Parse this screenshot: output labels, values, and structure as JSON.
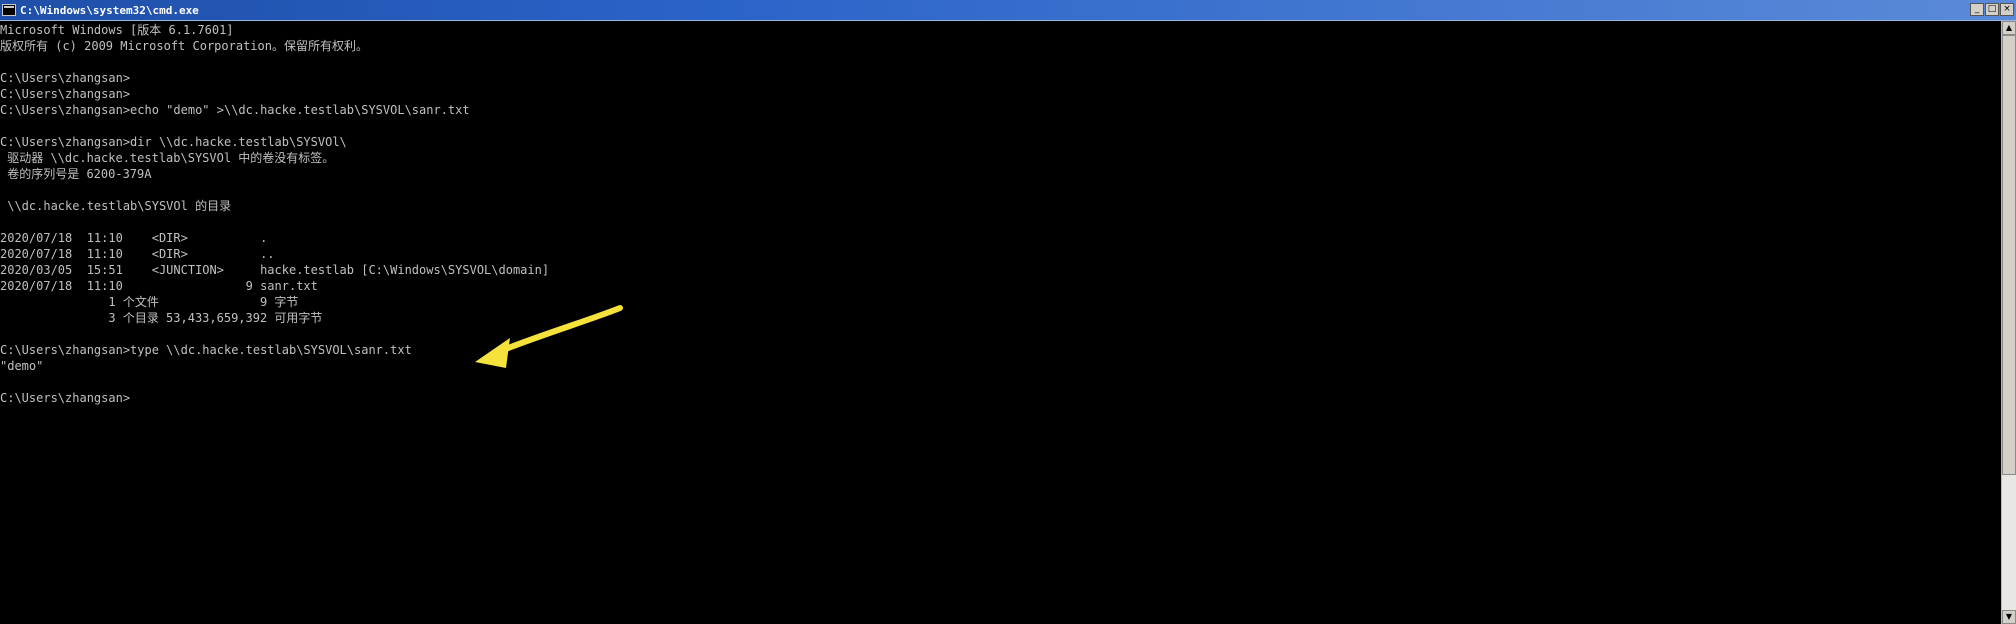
{
  "window": {
    "title": "C:\\Windows\\system32\\cmd.exe",
    "controls": {
      "minimize": "_",
      "maximize": "□",
      "close": "×"
    }
  },
  "console": {
    "lines": [
      "Microsoft Windows [版本 6.1.7601]",
      "版权所有 (c) 2009 Microsoft Corporation。保留所有权利。",
      "",
      "C:\\Users\\zhangsan>",
      "C:\\Users\\zhangsan>",
      "C:\\Users\\zhangsan>echo \"demo\" >\\\\dc.hacke.testlab\\SYSVOL\\sanr.txt",
      "",
      "C:\\Users\\zhangsan>dir \\\\dc.hacke.testlab\\SYSVOl\\",
      " 驱动器 \\\\dc.hacke.testlab\\SYSVOl 中的卷没有标签。",
      " 卷的序列号是 6200-379A",
      "",
      " \\\\dc.hacke.testlab\\SYSVOl 的目录",
      "",
      "2020/07/18  11:10    <DIR>          .",
      "2020/07/18  11:10    <DIR>          ..",
      "2020/03/05  15:51    <JUNCTION>     hacke.testlab [C:\\Windows\\SYSVOL\\domain]",
      "2020/07/18  11:10                 9 sanr.txt",
      "               1 个文件              9 字节",
      "               3 个目录 53,433,659,392 可用字节",
      "",
      "C:\\Users\\zhangsan>type \\\\dc.hacke.testlab\\SYSVOL\\sanr.txt",
      "\"demo\"",
      "",
      "C:\\Users\\zhangsan>"
    ]
  },
  "annotation": {
    "arrow_color": "#f5e23c"
  },
  "scrollbar": {
    "up_glyph": "▲",
    "down_glyph": "▼"
  }
}
